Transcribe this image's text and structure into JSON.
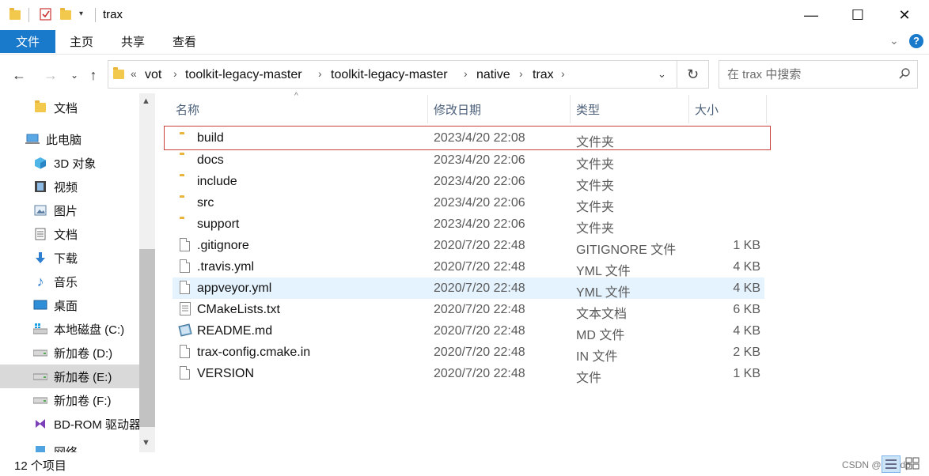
{
  "window": {
    "title": "trax",
    "minimize": "—",
    "maximize": "☐",
    "close": "✕"
  },
  "ribbon": {
    "tabs": [
      "文件",
      "主页",
      "共享",
      "查看"
    ]
  },
  "address": {
    "overflow": "«",
    "crumbs": [
      "vot",
      "toolkit-legacy-master",
      "toolkit-legacy-master",
      "native",
      "trax"
    ]
  },
  "search": {
    "placeholder": "在 trax 中搜索"
  },
  "sidebar": {
    "items": [
      {
        "label": "文档",
        "icon": "folder-icon"
      },
      {
        "label": "此电脑",
        "icon": "computer-icon"
      },
      {
        "label": "3D 对象",
        "icon": "cube-icon"
      },
      {
        "label": "视频",
        "icon": "video-icon"
      },
      {
        "label": "图片",
        "icon": "picture-icon"
      },
      {
        "label": "文档",
        "icon": "document-icon"
      },
      {
        "label": "下载",
        "icon": "download-icon"
      },
      {
        "label": "音乐",
        "icon": "music-icon"
      },
      {
        "label": "桌面",
        "icon": "desktop-icon"
      },
      {
        "label": "本地磁盘 (C:)",
        "icon": "windows-drive-icon"
      },
      {
        "label": "新加卷 (D:)",
        "icon": "drive-icon"
      },
      {
        "label": "新加卷 (E:)",
        "icon": "drive-icon"
      },
      {
        "label": "新加卷 (F:)",
        "icon": "drive-icon"
      },
      {
        "label": "BD-ROM 驱动器",
        "icon": "bd-rom-icon"
      },
      {
        "label": "网络",
        "icon": "network-icon"
      }
    ]
  },
  "columns": {
    "name": "名称",
    "date": "修改日期",
    "type": "类型",
    "size": "大小"
  },
  "files": [
    {
      "name": "build",
      "date": "2023/4/20 22:08",
      "type": "文件夹",
      "size": "",
      "kind": "folder"
    },
    {
      "name": "docs",
      "date": "2023/4/20 22:06",
      "type": "文件夹",
      "size": "",
      "kind": "folder"
    },
    {
      "name": "include",
      "date": "2023/4/20 22:06",
      "type": "文件夹",
      "size": "",
      "kind": "folder"
    },
    {
      "name": "src",
      "date": "2023/4/20 22:06",
      "type": "文件夹",
      "size": "",
      "kind": "folder"
    },
    {
      "name": "support",
      "date": "2023/4/20 22:06",
      "type": "文件夹",
      "size": "",
      "kind": "folder"
    },
    {
      "name": ".gitignore",
      "date": "2020/7/20 22:48",
      "type": "GITIGNORE 文件",
      "size": "1 KB",
      "kind": "file"
    },
    {
      "name": ".travis.yml",
      "date": "2020/7/20 22:48",
      "type": "YML 文件",
      "size": "4 KB",
      "kind": "file"
    },
    {
      "name": "appveyor.yml",
      "date": "2020/7/20 22:48",
      "type": "YML 文件",
      "size": "4 KB",
      "kind": "file"
    },
    {
      "name": "CMakeLists.txt",
      "date": "2020/7/20 22:48",
      "type": "文本文档",
      "size": "6 KB",
      "kind": "text"
    },
    {
      "name": "README.md",
      "date": "2020/7/20 22:48",
      "type": "MD 文件",
      "size": "4 KB",
      "kind": "markdown"
    },
    {
      "name": "trax-config.cmake.in",
      "date": "2020/7/20 22:48",
      "type": "IN 文件",
      "size": "2 KB",
      "kind": "file"
    },
    {
      "name": "VERSION",
      "date": "2020/7/20 22:48",
      "type": "文件",
      "size": "1 KB",
      "kind": "file"
    }
  ],
  "status": {
    "count": "12 个项目"
  },
  "watermark": "CSDN @小白dp",
  "colors": {
    "accent": "#1979ca",
    "selection_box": "#c9403a",
    "hover_row": "#e5f3ff",
    "folder": "#f2c94c"
  }
}
